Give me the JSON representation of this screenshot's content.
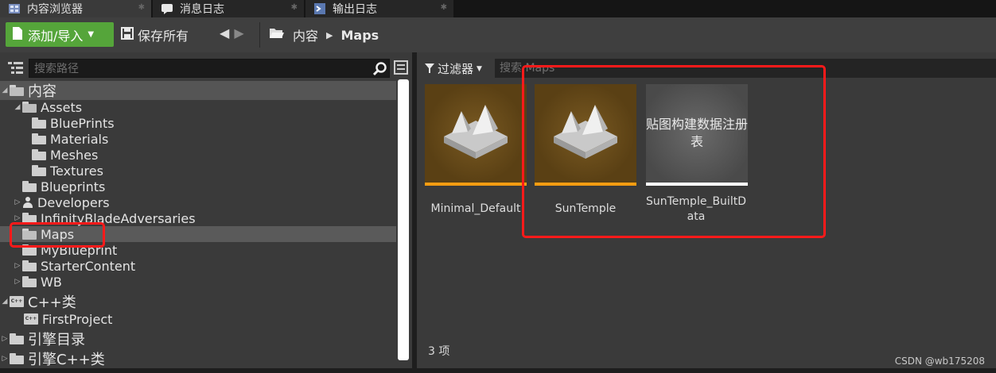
{
  "tabs": [
    {
      "label": "内容浏览器",
      "icon": "content-browser-icon",
      "active": true
    },
    {
      "label": "消息日志",
      "icon": "message-log-icon",
      "active": false
    },
    {
      "label": "输出日志",
      "icon": "output-log-icon",
      "active": false
    }
  ],
  "toolbar": {
    "add_label": "添加/导入",
    "save_label": "保存所有",
    "crumb_root": "内容",
    "crumb_current": "Maps"
  },
  "left": {
    "search_placeholder": "搜索路径",
    "tree": [
      {
        "label": "内容",
        "expanded": true,
        "root": true
      },
      {
        "label": "Assets",
        "expanded": true
      },
      {
        "label": "BluePrints"
      },
      {
        "label": "Materials"
      },
      {
        "label": "Meshes"
      },
      {
        "label": "Textures"
      },
      {
        "label": "Blueprints"
      },
      {
        "label": "Developers"
      },
      {
        "label": "InfinityBladeAdversaries"
      },
      {
        "label": "Maps",
        "selected": true
      },
      {
        "label": "MyBlueprint"
      },
      {
        "label": "StarterContent"
      },
      {
        "label": "WB"
      },
      {
        "label": "C++类",
        "root": true
      },
      {
        "label": "FirstProject"
      },
      {
        "label": "引擎目录",
        "root": true
      },
      {
        "label": "引擎C++类",
        "root": true
      }
    ]
  },
  "right": {
    "filter_label": "过滤器",
    "search_placeholder": "搜索 Maps",
    "assets": [
      {
        "name": "Minimal_Default",
        "type": "map"
      },
      {
        "name": "SunTemple",
        "type": "map"
      },
      {
        "name": "SunTemple_BuiltData",
        "type": "data",
        "thumb_text": "贴图构建数据注册表"
      }
    ],
    "count": "3 项"
  },
  "colors": {
    "accent_green": "#55a53a",
    "map_underline": "#f39c12",
    "highlight_red": "#ff1a1a"
  },
  "watermark": "CSDN @wb175208"
}
